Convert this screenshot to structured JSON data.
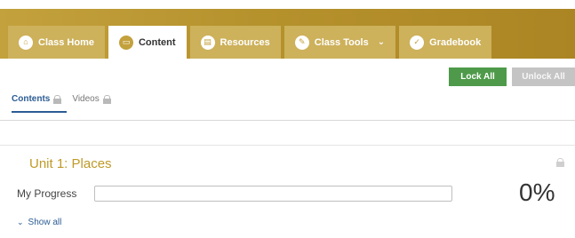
{
  "nav": {
    "tabs": [
      {
        "label": "Class Home",
        "icon": "home-icon"
      },
      {
        "label": "Content",
        "icon": "book-icon",
        "active": true
      },
      {
        "label": "Resources",
        "icon": "resources-icon"
      },
      {
        "label": "Class Tools",
        "icon": "wrench-icon",
        "dropdown": true
      },
      {
        "label": "Gradebook",
        "icon": "gradebook-icon"
      }
    ]
  },
  "actions": {
    "lock_all": "Lock All",
    "unlock_all": "Unlock All"
  },
  "subtabs": [
    {
      "label": "Contents",
      "active": true
    },
    {
      "label": "Videos",
      "active": false
    }
  ],
  "unit": {
    "title": "Unit 1: Places",
    "progress_label": "My Progress",
    "progress_value": 0,
    "progress_text": "0%",
    "show_all": "Show all"
  },
  "colors": {
    "brand_gold": "#c3a13d",
    "tab_gold": "#cdb15b",
    "lock_green": "#4e9a4a",
    "link_blue": "#2c5c94"
  }
}
